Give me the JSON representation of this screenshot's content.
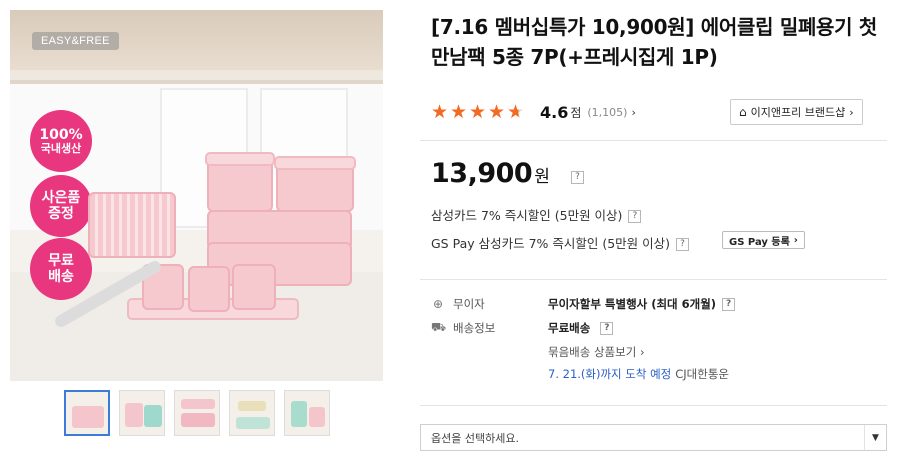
{
  "product": {
    "image_brand_tag": "EASY&FREE",
    "badges": [
      {
        "line1": "100%",
        "line2": "국내생산"
      },
      {
        "line1": "사은품",
        "line2": "증정"
      },
      {
        "line1": "무료",
        "line2": "배송"
      }
    ],
    "thumbnail_count": 5,
    "title": "[7.16 멤버십특가 10,900원] 에어클립 밀폐용기 첫만남팩 5종 7P(+프레시집게 1P)"
  },
  "rating": {
    "score": "4.6",
    "score_unit": "점",
    "review_count": "(1,105)",
    "stars_filled": 4.6,
    "chevron": "›"
  },
  "brand_shop": {
    "label": "이지앤프리 브랜드샵",
    "chevron": "›"
  },
  "price": {
    "amount": "13,900",
    "unit": "원",
    "help": "?"
  },
  "discounts": [
    {
      "text": "삼성카드 7% 즉시할인 (5만원 이상)",
      "help": "?"
    },
    {
      "text": "GS Pay 삼성카드 7% 즉시할인 (5만원 이상)",
      "help": "?"
    }
  ],
  "gspay_button": {
    "label": "GS Pay 등록",
    "chevron": "›"
  },
  "installment": {
    "label": "무이자",
    "value": "무이자할부 특별행사 (최대 6개월)",
    "help": "?"
  },
  "shipping": {
    "label": "배송정보",
    "free": "무료배송",
    "help": "?",
    "bundle_link": "묶음배송 상품보기 ›",
    "arrival_date": "7. 21.(화)까지 도착 예정",
    "carrier": "CJ대한통운"
  },
  "option_select": {
    "placeholder": "옵션을 선택하세요.",
    "arrow": "▼"
  },
  "colors": {
    "star": "#f36b22",
    "badge": "#e8367f",
    "arrival_blue": "#2a5fc7"
  }
}
